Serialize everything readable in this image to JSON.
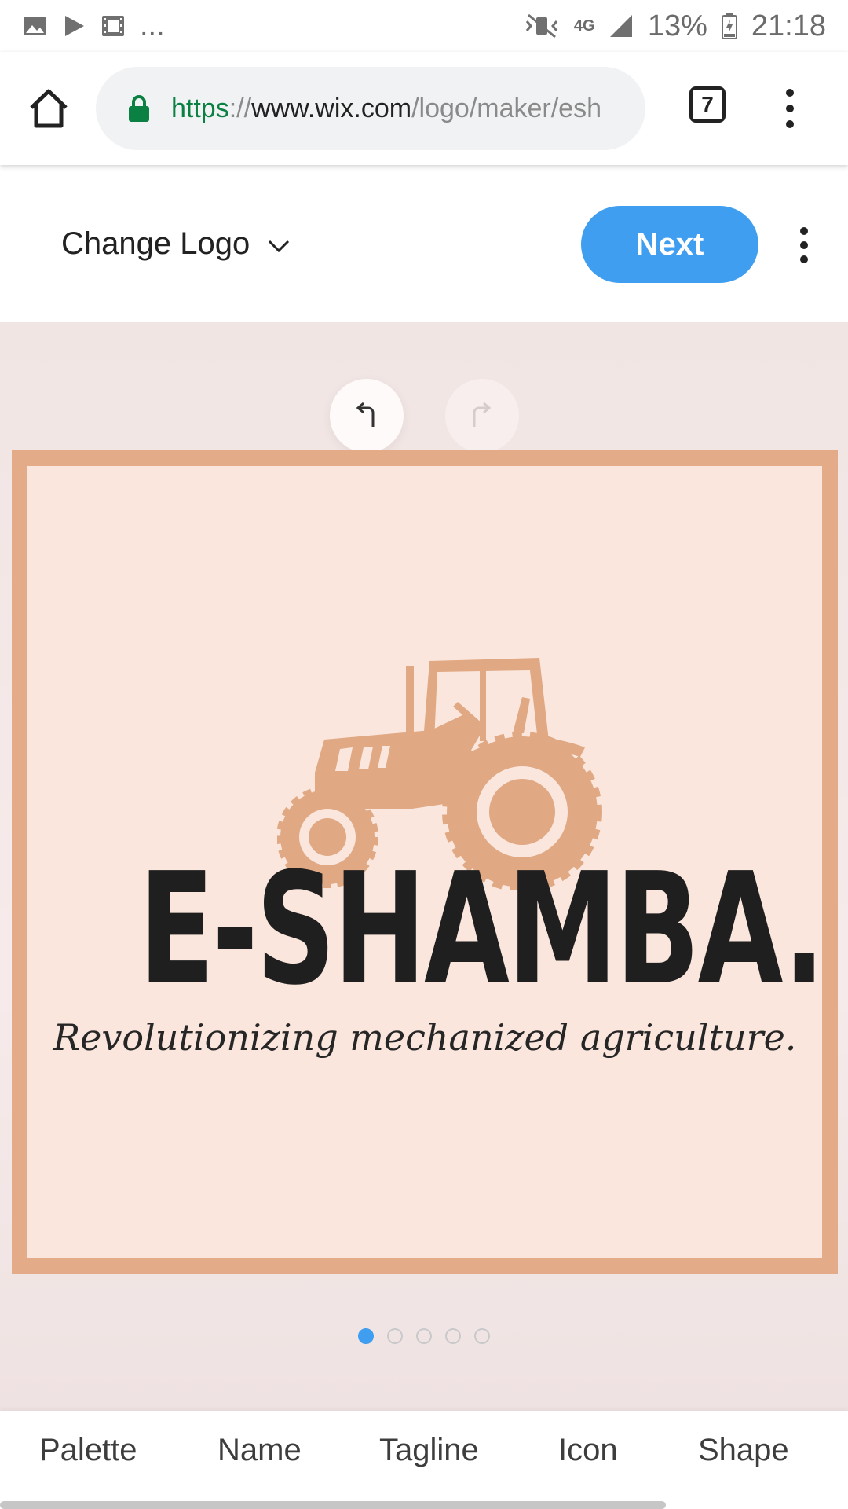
{
  "status_bar": {
    "left_icons": [
      "image-icon",
      "play-icon",
      "video-icon"
    ],
    "overflow": "...",
    "network": "4G",
    "battery": "13%",
    "time": "21:18"
  },
  "browser": {
    "url_scheme": "https",
    "url_sep": "://",
    "url_host": "www.wix.com",
    "url_path": "/logo/maker/esh",
    "tab_count": "7"
  },
  "header": {
    "change_logo_label": "Change Logo",
    "next_label": "Next"
  },
  "logo": {
    "name": "E-SHAMBA.",
    "tagline": "Revolutionizing mechanized agriculture.",
    "frame_color": "#e3ab87",
    "background_color": "#fae6dd",
    "text_color": "#1f1f1f",
    "icon": "tractor-icon"
  },
  "carousel": {
    "page_count": 5,
    "active_index": 0
  },
  "bottom_tabs": [
    "Palette",
    "Name",
    "Tagline",
    "Icon",
    "Shape"
  ],
  "colors": {
    "accent": "#3f9ef0"
  }
}
